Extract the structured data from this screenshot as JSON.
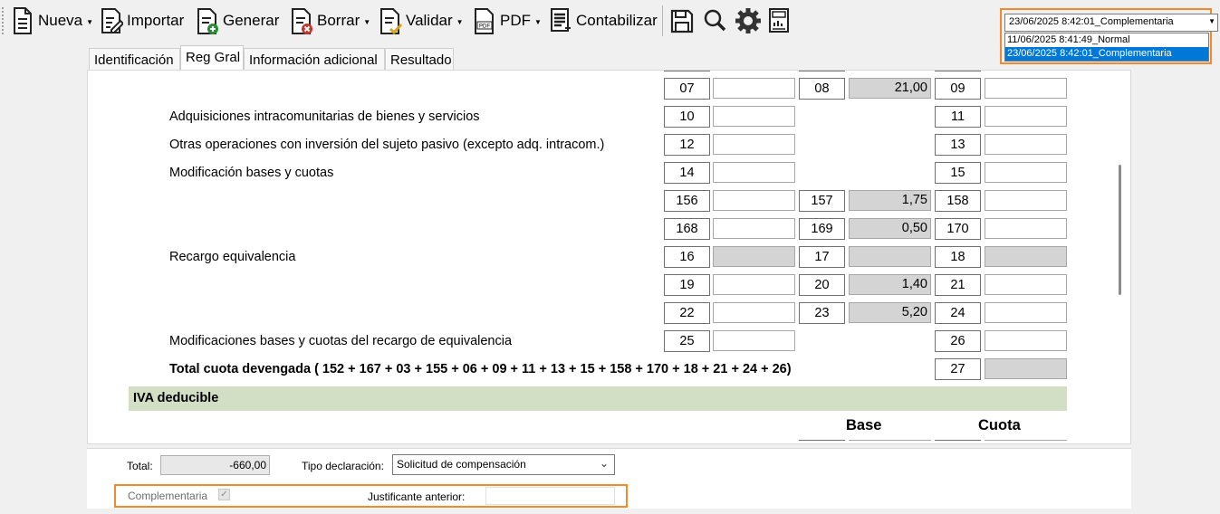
{
  "toolbar": {
    "nueva": "Nueva",
    "importar": "Importar",
    "generar": "Generar",
    "borrar": "Borrar",
    "validar": "Validar",
    "pdf": "PDF",
    "contabilizar": "Contabilizar"
  },
  "version": {
    "selected": "23/06/2025 8:42:01_Complementaria",
    "options": [
      "11/06/2025 8:41:49_Normal",
      "23/06/2025 8:42:01_Complementaria"
    ]
  },
  "tabs": [
    "Identificación",
    "Reg Gral",
    "Información adicional",
    "Resultado"
  ],
  "rows": {
    "adq_intracom": "Adquisiciones intracomunitarias de bienes y servicios",
    "otras_op": "Otras operaciones con inversión del sujeto pasivo (excepto adq. intracom.)",
    "modif": "Modificación bases y cuotas",
    "recargo": "Recargo equivalencia",
    "modif_recargo": "Modificaciones bases y cuotas del recargo de equivalencia",
    "total_cuota": "Total cuota devengada ( 152 + 167 + 03 + 155 + 06 + 09 + 11 + 13 + 15 + 158 + 170 + 18 + 21 + 24 + 26)"
  },
  "boxes": {
    "b07": "07",
    "b08": "08",
    "b09": "09",
    "b10": "10",
    "b11": "11",
    "b12": "12",
    "b13": "13",
    "b14": "14",
    "b15": "15",
    "b156": "156",
    "b157": "157",
    "b158": "158",
    "b168": "168",
    "b169": "169",
    "b170": "170",
    "b16": "16",
    "b17": "17",
    "b18": "18",
    "b19": "19",
    "b20": "20",
    "b21": "21",
    "b22": "22",
    "b23": "23",
    "b24": "24",
    "b25": "25",
    "b26": "26",
    "b27": "27"
  },
  "values": {
    "v08": "21,00",
    "v157": "1,75",
    "v169": "0,50",
    "v20": "1,40",
    "v23": "5,20"
  },
  "section_iva": "IVA deducible",
  "col_base": "Base",
  "col_cuota": "Cuota",
  "bottom": {
    "total_label": "Total:",
    "total_value": "-660,00",
    "tipo_label": "Tipo declaración:",
    "tipo_value": "Solicitud de compensación",
    "complementaria_label": "Complementaria",
    "justificante_label": "Justificante anterior:"
  }
}
